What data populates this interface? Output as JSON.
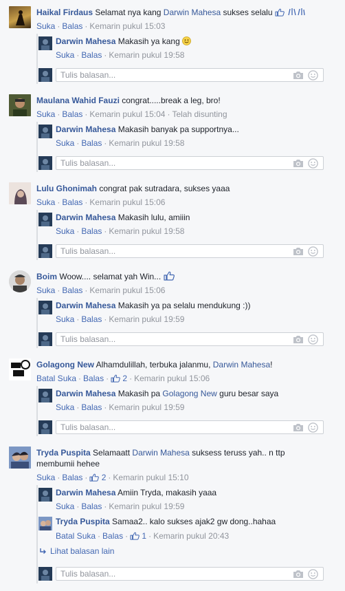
{
  "common": {
    "like": "Suka",
    "reply": "Balas",
    "unlike": "Batal Suka",
    "reply_placeholder": "Tulis balasan...",
    "sep": "·"
  },
  "threads": [
    {
      "author": "Haikal Firdaus",
      "text": "Selamat nya kang ",
      "mention": "Darwin Mahesa",
      "text_after": " sukses selalu",
      "time": "Kemarin pukul 15:03",
      "replies": [
        {
          "author": "Darwin Mahesa",
          "text": "Makasih ya kang",
          "time": "Kemarin pukul 19:58"
        }
      ]
    },
    {
      "author": "Maulana Wahid Fauzi",
      "text": "congrat.....break a leg, bro!",
      "time": "Kemarin pukul 15:04",
      "edited": "Telah disunting",
      "replies": [
        {
          "author": "Darwin Mahesa",
          "text": "Makasih banyak pa supportnya...",
          "time": "Kemarin pukul 19:58"
        }
      ]
    },
    {
      "author": "Lulu Ghonimah",
      "text": "congrat pak sutradara, sukses yaaa",
      "time": "Kemarin pukul 15:06",
      "replies": [
        {
          "author": "Darwin Mahesa",
          "text": "Makasih lulu, amiiin",
          "time": "Kemarin pukul 19:58"
        }
      ]
    },
    {
      "author": "Boim",
      "text": "Woow.... selamat yah Win...",
      "time": "Kemarin pukul 15:06",
      "replies": [
        {
          "author": "Darwin Mahesa",
          "text": "Makasih ya pa selalu mendukung :))",
          "time": "Kemarin pukul 19:59"
        }
      ]
    },
    {
      "author": "Golagong New",
      "text": "Alhamdulillah, terbuka jalanmu, ",
      "mention": "Darwin Mahesa",
      "text_after": "!",
      "likes": "2",
      "time": "Kemarin pukul 15:06",
      "replies": [
        {
          "author": "Darwin Mahesa",
          "text": "Makasih pa ",
          "mention": "Golagong New",
          "text_after": " guru besar saya",
          "time": "Kemarin pukul 19:59"
        }
      ]
    },
    {
      "author": "Tryda Puspita",
      "text": "Selamaatt ",
      "mention": "Darwin Mahesa",
      "text_after": " suksess teruss yah.. n ttp membumii hehee",
      "likes": "2",
      "time": "Kemarin pukul 15:10",
      "replies": [
        {
          "author": "Darwin Mahesa",
          "text": "Amiin Tryda, makasih yaaa",
          "time": "Kemarin pukul 19:59"
        },
        {
          "author": "Tryda Puspita",
          "text": "Samaa2.. kalo sukses ajak2 gw dong..hahaa",
          "likes": "1",
          "time": "Kemarin pukul 20:43"
        }
      ],
      "more_replies": "Lihat balasan lain"
    }
  ]
}
